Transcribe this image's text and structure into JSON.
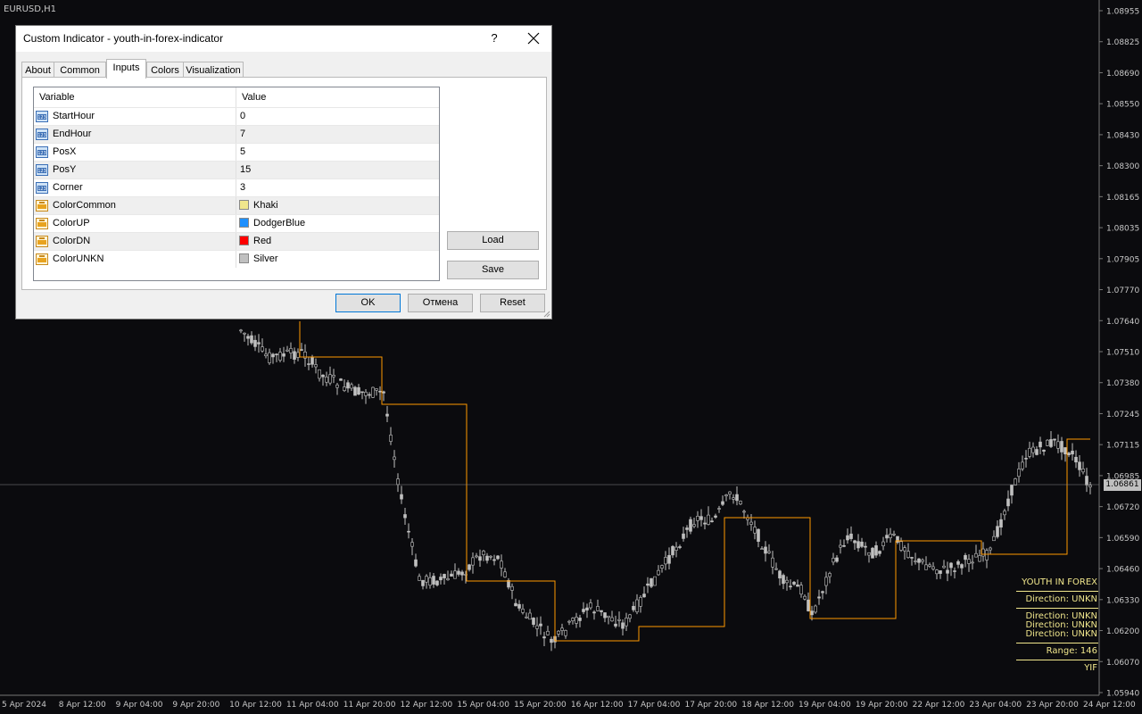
{
  "symbol": "EURUSD,H1",
  "current_price": "1.06861",
  "price_axis": [
    "1.08955",
    "1.08825",
    "1.08690",
    "1.08550",
    "1.08430",
    "1.08300",
    "1.08165",
    "1.08035",
    "1.07905",
    "1.07770",
    "1.07640",
    "1.07510",
    "1.07380",
    "1.07245",
    "1.07115",
    "1.06985",
    "1.06720",
    "1.06590",
    "1.06460",
    "1.06330",
    "1.06200",
    "1.06070",
    "1.05940"
  ],
  "time_axis": [
    "5 Apr 2024",
    "8 Apr 12:00",
    "9 Apr 04:00",
    "9 Apr 20:00",
    "10 Apr 12:00",
    "11 Apr 04:00",
    "11 Apr 20:00",
    "12 Apr 12:00",
    "15 Apr 04:00",
    "15 Apr 20:00",
    "16 Apr 12:00",
    "17 Apr 04:00",
    "17 Apr 20:00",
    "18 Apr 12:00",
    "19 Apr 04:00",
    "19 Apr 20:00",
    "22 Apr 12:00",
    "23 Apr 04:00",
    "23 Apr 20:00",
    "24 Apr 12:00"
  ],
  "indicator_panel": {
    "title": "YOUTH IN FOREX",
    "direction_main": "Direction: UNKN",
    "directions": [
      "Direction: UNKN",
      "Direction: UNKN",
      "Direction: UNKN"
    ],
    "range": "Range: 146",
    "footer": "YIF"
  },
  "colors": {
    "background": "#0b0b0e",
    "candle": "#c0c0c0",
    "indicator_line": "#ff9900",
    "panel_text": "#f0e68c",
    "dialog_bg": "#f0f0f0",
    "default_button_border": "#0078d7"
  },
  "dialog": {
    "title": "Custom Indicator - youth-in-forex-indicator",
    "help_label": "?",
    "tabs": [
      "About",
      "Common",
      "Inputs",
      "Colors",
      "Visualization"
    ],
    "active_tab": "Inputs",
    "grid_headers": {
      "variable": "Variable",
      "value": "Value"
    },
    "inputs": [
      {
        "name": "StartHour",
        "value": "0",
        "type": "int"
      },
      {
        "name": "EndHour",
        "value": "7",
        "type": "int"
      },
      {
        "name": "PosX",
        "value": "5",
        "type": "int"
      },
      {
        "name": "PosY",
        "value": "15",
        "type": "int"
      },
      {
        "name": "Corner",
        "value": "3",
        "type": "int"
      },
      {
        "name": "ColorCommon",
        "value": "Khaki",
        "type": "color",
        "color": "#f0e68c"
      },
      {
        "name": "ColorUP",
        "value": "DodgerBlue",
        "type": "color",
        "color": "#1e90ff"
      },
      {
        "name": "ColorDN",
        "value": "Red",
        "type": "color",
        "color": "#ff0000"
      },
      {
        "name": "ColorUNKN",
        "value": "Silver",
        "type": "color",
        "color": "#c0c0c0"
      }
    ],
    "load_label": "Load",
    "save_label": "Save",
    "ok_label": "OK",
    "cancel_label": "Отмена",
    "reset_label": "Reset"
  }
}
